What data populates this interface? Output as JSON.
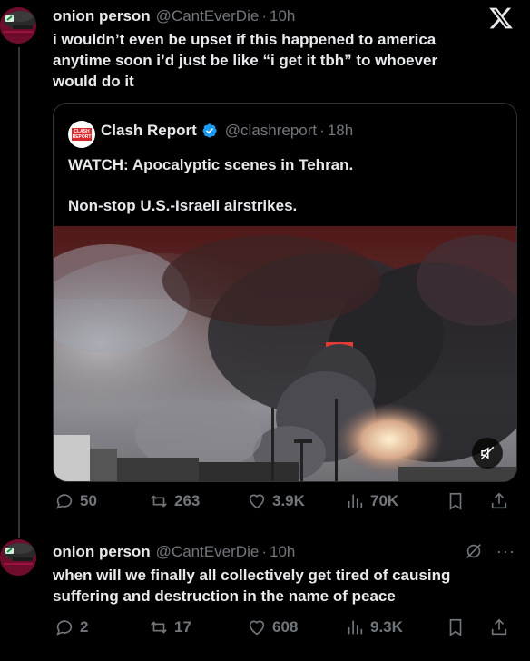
{
  "brand": {
    "x_icon": "x-logo-icon"
  },
  "post1": {
    "author_name": "onion person",
    "handle": "@CantEverDie",
    "separator": "·",
    "time": "10h",
    "text_lines": [
      "i wouldn’t even be upset if this happened to america",
      "anytime soon i’d just be like “i get it tbh” to whoever",
      "would do it"
    ],
    "quote": {
      "author_name": "Clash Report",
      "logo_text": "CLASH REPORT",
      "verified_icon": "verified-badge-icon",
      "handle": "@clashreport",
      "separator": "·",
      "time": "18h",
      "text_line1": "WATCH: Apocalyptic scenes in Tehran.",
      "text_line2": "Non-stop U.S.-Israeli airstrikes.",
      "media": {
        "type": "video",
        "mute_icon": "muted-speaker-icon"
      }
    },
    "stats": {
      "replies": "50",
      "reposts": "263",
      "likes": "3.9K",
      "views": "70K"
    }
  },
  "post2": {
    "author_name": "onion person",
    "handle": "@CantEverDie",
    "separator": "·",
    "time": "10h",
    "text_lines": [
      "when will we finally all collectively get tired of causing",
      "suffering and destruction in the name of peace"
    ],
    "more_label": "···",
    "stats": {
      "replies": "2",
      "reposts": "17",
      "likes": "608",
      "views": "9.3K"
    }
  },
  "icons": {
    "reply": "reply-icon",
    "repost": "repost-icon",
    "like": "like-icon",
    "views": "views-icon",
    "bookmark": "bookmark-icon",
    "share": "share-icon",
    "grok": "grok-icon",
    "more": "more-icon"
  },
  "colors": {
    "background": "#000000",
    "text": "#e7e9ea",
    "muted": "#71767b",
    "verified": "#1d9bf0",
    "border": "#2f3336"
  }
}
